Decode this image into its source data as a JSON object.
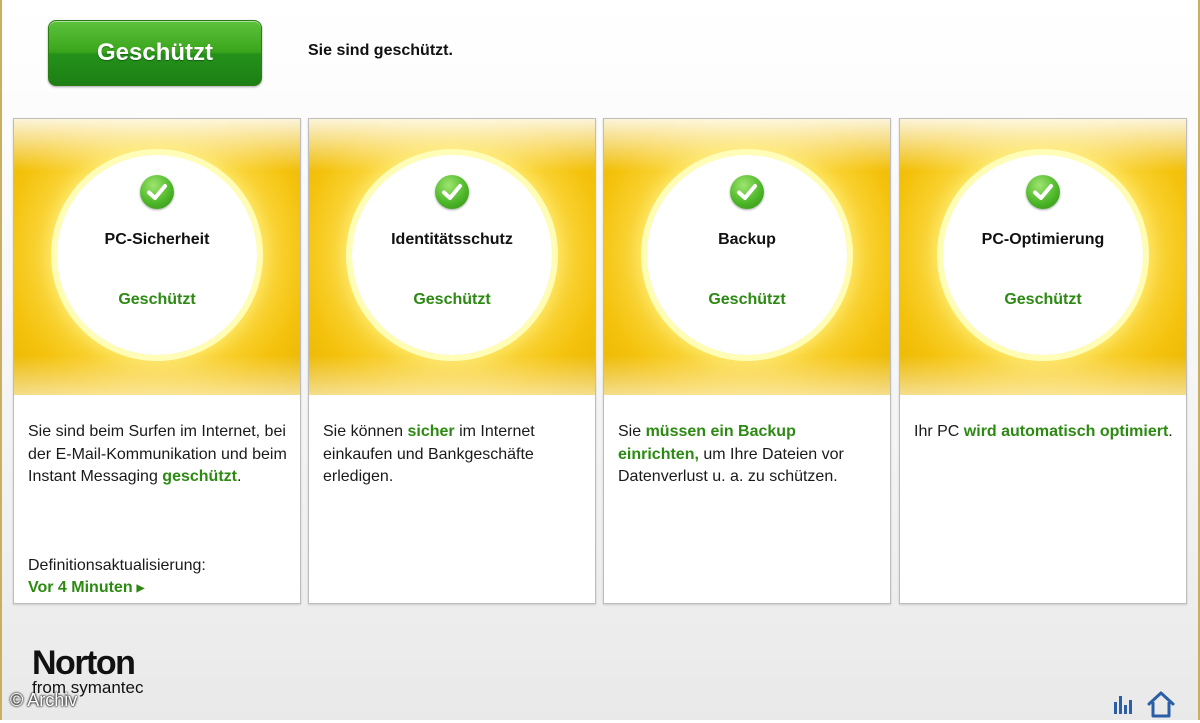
{
  "header": {
    "status_button": "Geschützt",
    "status_message": "Sie sind geschützt.",
    "status_button_color": "#3aa51c"
  },
  "panels": [
    {
      "title": "PC-Sicherheit",
      "status": "Geschützt",
      "icon": "green-check-icon",
      "desc_parts": [
        "Sie sind beim Surfen im Internet, bei der E-Mail-Kommunikation und beim Instant Messaging ",
        "geschützt",
        "."
      ],
      "footer_label": "Definitionsaktualisierung:",
      "footer_link": "Vor 4 Minuten"
    },
    {
      "title": "Identitätsschutz",
      "status": "Geschützt",
      "icon": "green-check-icon",
      "desc_parts": [
        "Sie können ",
        "sicher",
        " im Internet einkaufen und Bankgeschäfte erledigen."
      ]
    },
    {
      "title": "Backup",
      "status": "Geschützt",
      "icon": "green-check-icon",
      "desc_parts": [
        "Sie ",
        "müssen ein Backup einrichten,",
        " um Ihre Dateien vor Datenverlust u. a. zu schützen."
      ]
    },
    {
      "title": "PC-Optimierung",
      "status": "Geschützt",
      "icon": "green-check-icon",
      "desc_parts": [
        "Ihr PC ",
        "wird automatisch optimiert",
        "."
      ]
    }
  ],
  "footer": {
    "logo_word": "Norton",
    "logo_sub": "from symantec",
    "watermark": "© Archiv",
    "icons": [
      "bar-chart-icon",
      "home-icon"
    ]
  },
  "colors": {
    "accent_green": "#2c8a12",
    "panel_yellow": "#f4c20d"
  }
}
